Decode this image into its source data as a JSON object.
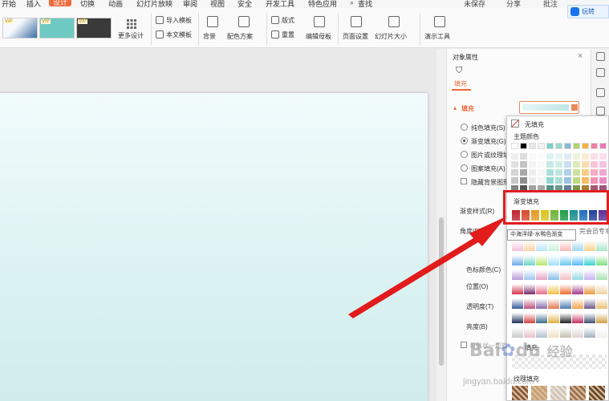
{
  "menu": {
    "items": [
      "开始",
      "插入",
      "设计",
      "切换",
      "动画",
      "幻灯片放映",
      "审阅",
      "视图",
      "安全",
      "开发工具",
      "特色应用"
    ],
    "search": "查找",
    "right": [
      "未保存",
      "分享",
      "批注"
    ],
    "active_index": 2,
    "accent": "#ee6a3a"
  },
  "ribbon": {
    "more_designs": "更多设计",
    "import_template": "导入模板",
    "text_template": "本文模板",
    "background": "背景",
    "color_scheme": "配色方案",
    "layout": "版式",
    "reset": "重置",
    "edit_master": "编辑母板",
    "page_setup": "页面设置",
    "slide_size": "幻灯片大小",
    "presentation_tools": "演示工具",
    "vip": "VIP",
    "templates": [
      {
        "bg": "#e9eef4"
      },
      {
        "bg": "#6ec9c3"
      },
      {
        "bg": "#3a3a3a"
      }
    ]
  },
  "topright_button": "玩转",
  "pane": {
    "title": "对象属性",
    "tab": "填充",
    "section": "填充",
    "options": [
      "纯色填充(S)",
      "渐变填充(G)",
      "图片或纹理填",
      "图案填充(A)"
    ],
    "hide_bg": "隐藏背景图形",
    "gradient_style": "渐变样式(R)",
    "angle": "角度(E)",
    "stop_color": "色标颜色(C)",
    "position": "位置(O)",
    "transparency": "透明度(T)",
    "brightness": "亮度(B)",
    "rotate_with_shape": "与形状一起旋转"
  },
  "popup": {
    "no_fill": "无填充",
    "theme_colors": "主题颜色",
    "gradient_fill": "渐变填充",
    "member_tag": "完会员专享",
    "more_fill": "填充",
    "texture_fill": "纹理填充",
    "tooltip": "中海洋绿-水鸭色渐变",
    "theme_top": [
      "#ffffff",
      "#000000",
      "#e7e6e6",
      "#f2f2f2",
      "#7ccfc7",
      "#9bd8cf",
      "#89b8d8",
      "#b3d36b",
      "#f2b24a",
      "#ef7fa1",
      "#e879b8"
    ],
    "gradient_row": [
      "#c0262d",
      "#d64a2b",
      "#e59a1f",
      "#d8c51a",
      "#6fb33c",
      "#1f9c4a",
      "#1a8f8f",
      "#1f6fb8",
      "#24409a",
      "#5b2f99"
    ]
  },
  "watermark": {
    "brand": "Bai",
    "du": "du",
    "product": "经验",
    "url": "jingyan.baidu.com"
  }
}
